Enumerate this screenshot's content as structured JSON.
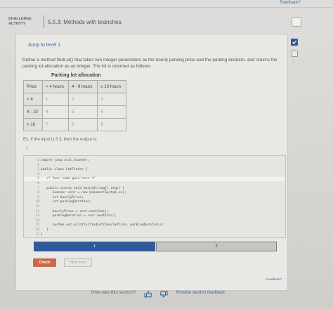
{
  "header": {
    "feedback_link": "Feedback?",
    "challenge_label": "CHALLENGE ACTIVITY",
    "activity_title": "5.5.3: Methods with branches."
  },
  "card": {
    "tag": "",
    "jump_link": "Jump to level 1",
    "problem_text": "Define a method findLot() that takes two integer parameters as the hourly parking price and the parking duration, and returns the parking lot allocation as an integer. The lot is returned as follows:",
    "table_title": "Parking lot allocation",
    "table": {
      "header": [
        "Price",
        "< 4 hours",
        "4 - 9 hours",
        "≥ 10 hours"
      ],
      "rows": [
        {
          "label": "< 4",
          "values": [
            "1",
            "2",
            "3"
          ]
        },
        {
          "label": "4 - 10",
          "values": [
            "4",
            "5",
            "6"
          ]
        },
        {
          "label": "> 10",
          "values": [
            "7",
            "8",
            "9"
          ]
        }
      ]
    },
    "example_text": "Ex: If the input is 3 3, then the output is:",
    "example_output": "1",
    "code_lines": [
      {
        "num": "1",
        "text": "import java.util.Scanner;"
      },
      {
        "num": "2",
        "text": ""
      },
      {
        "num": "3",
        "text": "public class LotFinder {"
      },
      {
        "num": "4",
        "text": ""
      },
      {
        "num": "5",
        "text": "   /* Your code goes here */"
      },
      {
        "num": "6",
        "text": ""
      },
      {
        "num": "7",
        "text": "   public static void main(String[] args) {"
      },
      {
        "num": "8",
        "text": "      Scanner scnr = new Scanner(System.in);"
      },
      {
        "num": "9",
        "text": "      int hourlyPrice;"
      },
      {
        "num": "10",
        "text": "      int parkingDuration;"
      },
      {
        "num": "11",
        "text": ""
      },
      {
        "num": "12",
        "text": "      hourlyPrice = scnr.nextInt();"
      },
      {
        "num": "13",
        "text": "      parkingDuration = scnr.nextInt();"
      },
      {
        "num": "14",
        "text": ""
      },
      {
        "num": "15",
        "text": "      System.out.println(findLot(hourlyPrice, parkingDuration));"
      },
      {
        "num": "16",
        "text": "   }"
      },
      {
        "num": "17",
        "text": "}"
      }
    ],
    "levels": [
      "1",
      "2"
    ],
    "check_label": "Check",
    "next_label": "Next level",
    "feedback_link": "Feedback?"
  },
  "sidebar": {
    "level_number": "2"
  },
  "footer": {
    "question": "How was this section?",
    "provide_feedback": "Provide section feedback"
  },
  "colors": {
    "accent_blue": "#2f5a9a",
    "check_orange": "#c96a4a",
    "link_blue": "#2f63a8"
  }
}
